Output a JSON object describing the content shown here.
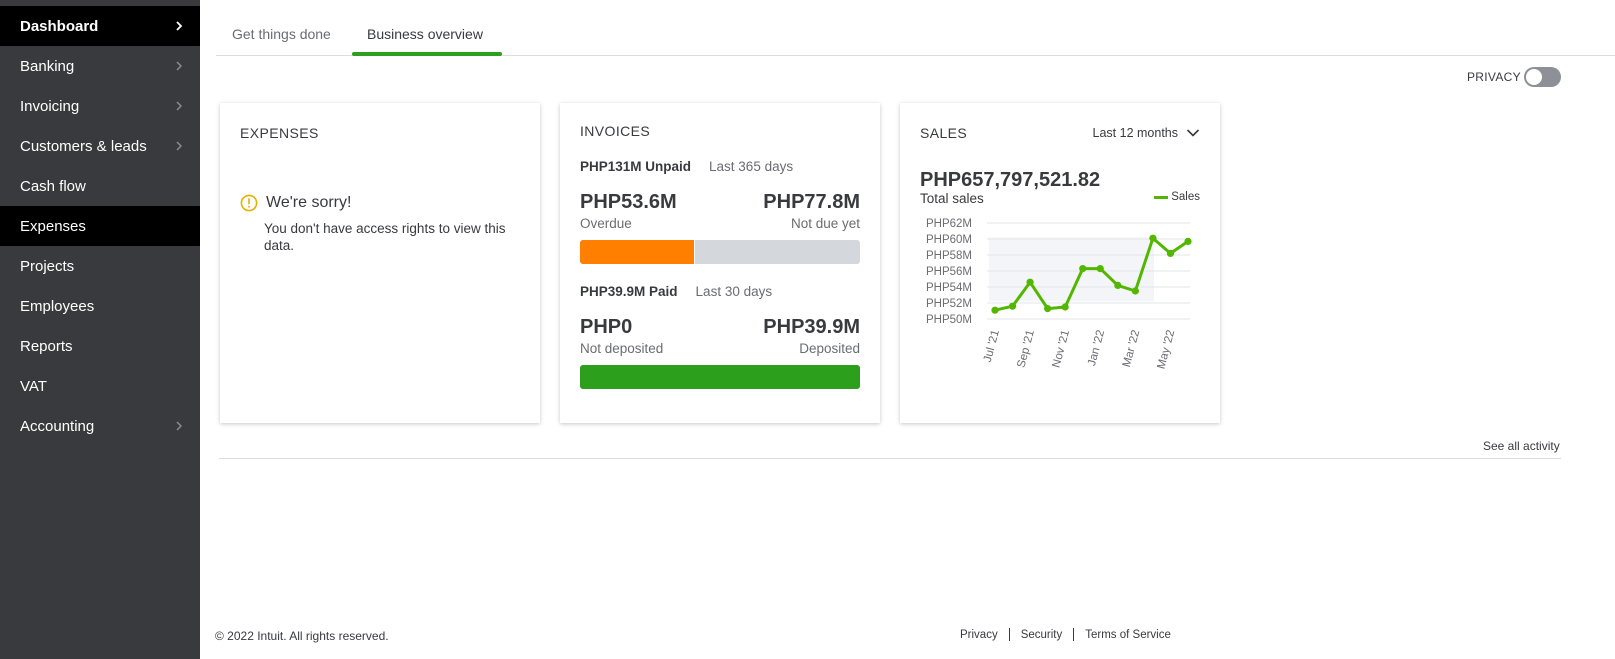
{
  "sidebar": {
    "items": [
      {
        "label": "Dashboard",
        "chevron": true,
        "active": true
      },
      {
        "label": "Banking",
        "chevron": true,
        "active": false
      },
      {
        "label": "Invoicing",
        "chevron": true,
        "active": false
      },
      {
        "label": "Customers & leads",
        "chevron": true,
        "active": false
      },
      {
        "label": "Cash flow",
        "chevron": false,
        "active": false
      },
      {
        "label": "Expenses",
        "chevron": false,
        "active": true
      },
      {
        "label": "Projects",
        "chevron": false,
        "active": false
      },
      {
        "label": "Employees",
        "chevron": false,
        "active": false
      },
      {
        "label": "Reports",
        "chevron": false,
        "active": false
      },
      {
        "label": "VAT",
        "chevron": false,
        "active": false
      },
      {
        "label": "Accounting",
        "chevron": true,
        "active": false
      }
    ]
  },
  "tabs": [
    {
      "label": "Get things done",
      "active": false
    },
    {
      "label": "Business overview",
      "active": true
    }
  ],
  "privacy": {
    "label": "PRIVACY",
    "enabled": false
  },
  "expenses": {
    "title": "EXPENSES",
    "sorry_title": "We're sorry!",
    "sorry_text": "You don't have access rights to view this data."
  },
  "invoices": {
    "title": "INVOICES",
    "unpaid_amount": "PHP131M Unpaid",
    "unpaid_period": "Last 365 days",
    "overdue_value": "PHP53.6M",
    "overdue_label": "Overdue",
    "not_due_value": "PHP77.8M",
    "not_due_label": "Not due yet",
    "unpaid_overdue_fraction": 0.409,
    "paid_amount": "PHP39.9M Paid",
    "paid_period": "Last 30 days",
    "not_deposited_value": "PHP0",
    "not_deposited_label": "Not deposited",
    "deposited_value": "PHP39.9M",
    "deposited_label": "Deposited",
    "paid_deposited_fraction": 1.0
  },
  "sales": {
    "title": "SALES",
    "period_label": "Last 12 months",
    "total_value": "PHP657,797,521.82",
    "total_label": "Total sales"
  },
  "chart_data": {
    "type": "line",
    "title": "",
    "series": [
      {
        "name": "Sales",
        "values": [
          51.1,
          51.6,
          54.6,
          51.3,
          51.5,
          56.3,
          56.3,
          54.2,
          53.5,
          60.1,
          58.2,
          59.7
        ]
      }
    ],
    "x": [
      "Jul '21",
      "Aug '21",
      "Sep '21",
      "Oct '21",
      "Nov '21",
      "Dec '21",
      "Jan '22",
      "Feb '22",
      "Mar '22",
      "Apr '22",
      "May '22",
      "Jun '22"
    ],
    "x_tick_labels": [
      "Jul '21",
      "Sep '21",
      "Nov '21",
      "Jan '22",
      "Mar '22",
      "May '22"
    ],
    "y_tick_labels": [
      "PHP62M",
      "PHP60M",
      "PHP58M",
      "PHP56M",
      "PHP54M",
      "PHP52M",
      "PHP50M"
    ],
    "ylim": [
      50,
      62
    ],
    "grid": true,
    "legend": "top-right",
    "color": "#53b700"
  },
  "activity": {
    "see_all": "See all activity"
  },
  "footer": {
    "copyright": "© 2022 Intuit. All rights reserved.",
    "links": [
      "Privacy",
      "Security",
      "Terms of Service"
    ]
  },
  "colors": {
    "sidebar_bg": "#393a3d",
    "active_bg": "#000000",
    "accent_green": "#2ca01c",
    "overdue_orange": "#ff8000",
    "bar_gray": "#d4d7dc"
  }
}
